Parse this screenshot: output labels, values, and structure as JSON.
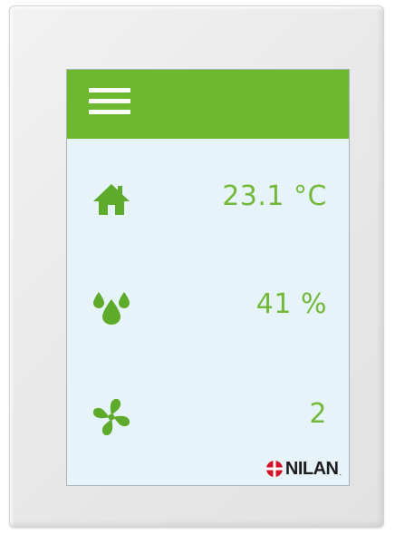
{
  "colors": {
    "accent": "#6cb82f",
    "value_text": "#73b83a",
    "screen_bg": "#e6f4f9",
    "logo_red": "#d4122a"
  },
  "header": {
    "menu_icon": "hamburger-menu-icon"
  },
  "readings": [
    {
      "icon": "house-icon",
      "value": "23.1 °C"
    },
    {
      "icon": "humidity-drops-icon",
      "value": "41 %"
    },
    {
      "icon": "fan-icon",
      "value": "2"
    }
  ],
  "brand": {
    "name": "NILAN",
    "mark": "nilan-logo-mark"
  }
}
